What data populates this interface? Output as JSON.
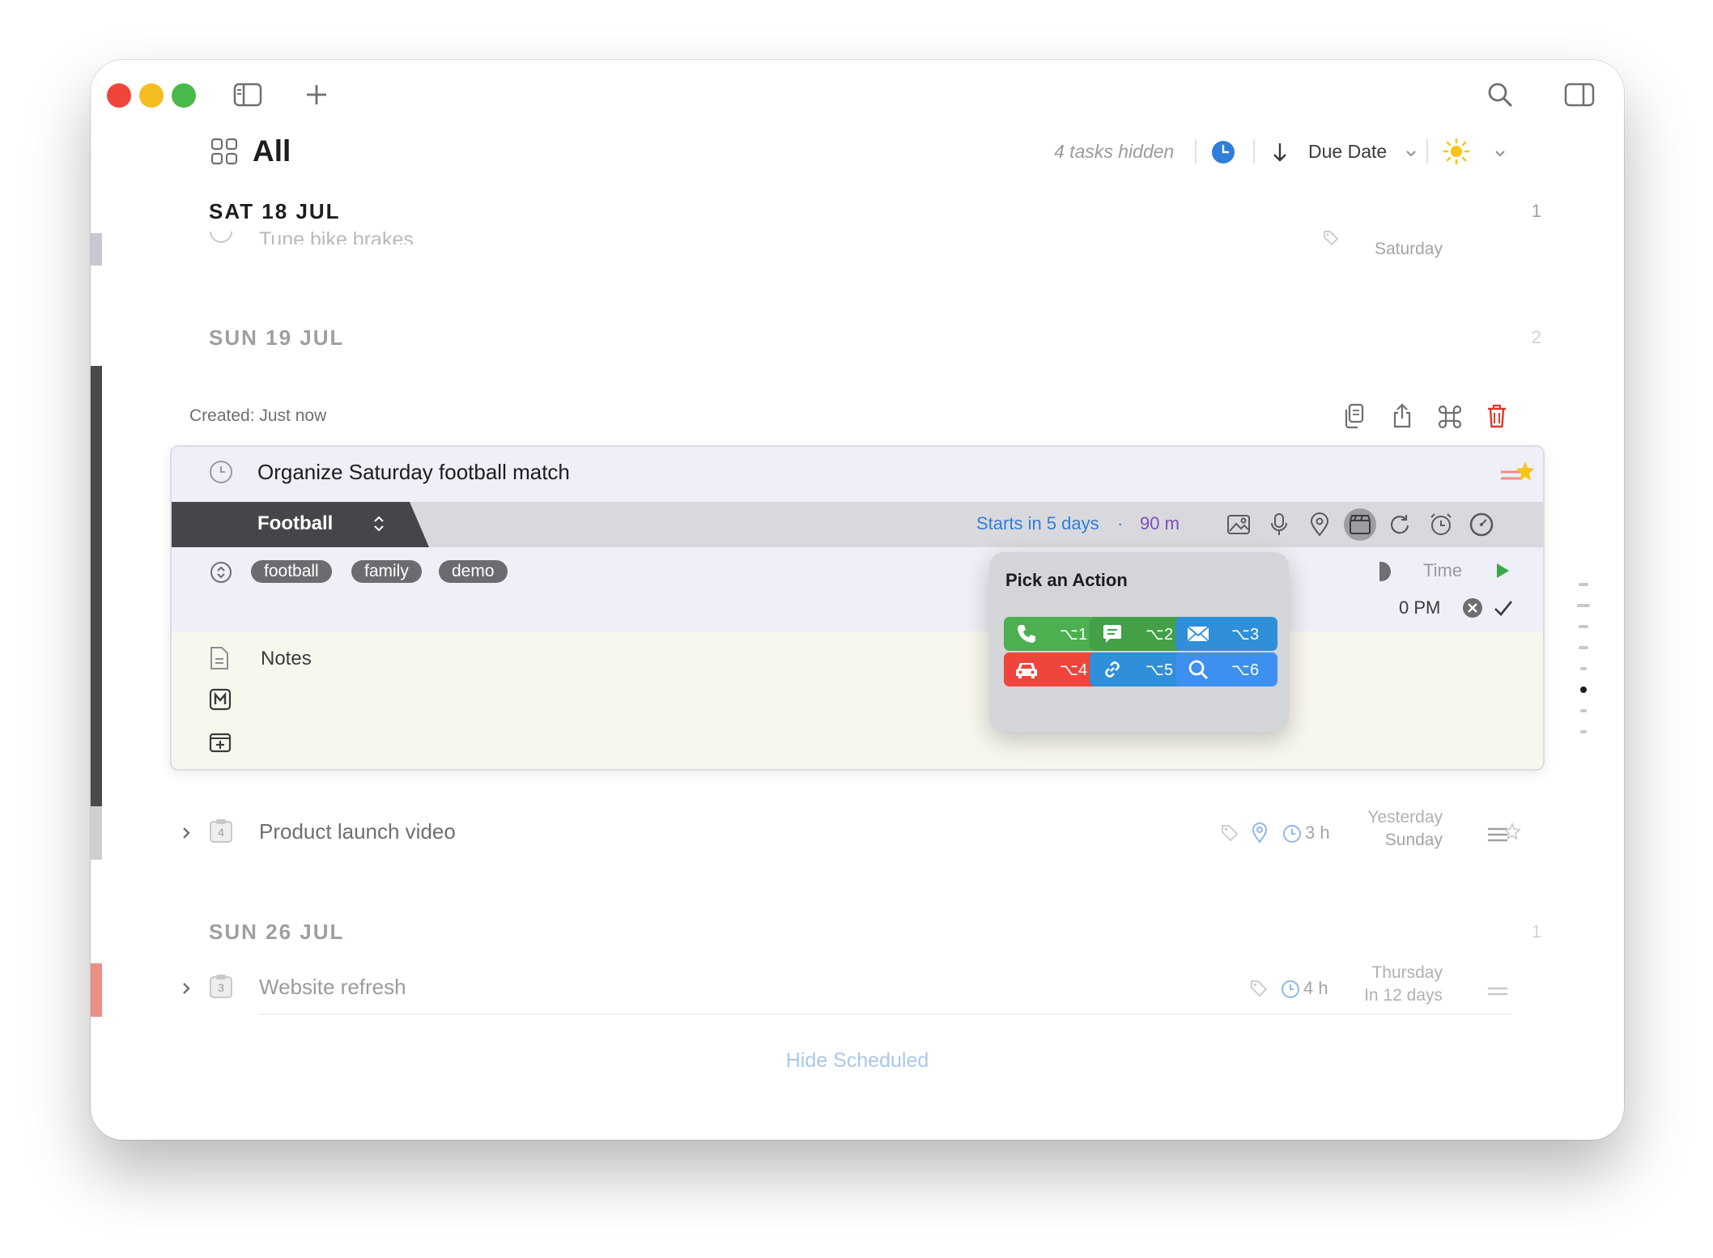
{
  "header": {
    "title": "All",
    "hidden_count": "4 tasks hidden",
    "sort_label": "Due Date"
  },
  "sections": [
    {
      "date": "SAT 18 JUL",
      "count": "1"
    },
    {
      "date": "SUN 19 JUL",
      "count": "2"
    },
    {
      "date": "SUN 26 JUL",
      "count": "1"
    }
  ],
  "tasks": {
    "tune": {
      "title": "Tune bike brakes",
      "date": "Saturday"
    },
    "product": {
      "title": "Product launch video",
      "badge": "4",
      "duration": "3 h",
      "date_line1": "Yesterday",
      "date_line2": "Sunday"
    },
    "website": {
      "title": "Website refresh",
      "badge": "3",
      "duration": "4 h",
      "date_line1": "Thursday",
      "date_line2": "In 12 days"
    }
  },
  "editor": {
    "created": "Created: Just now",
    "title": "Organize Saturday football match",
    "project": "Football",
    "starts": "Starts in 5 days",
    "dot": "·",
    "duration": "90 m",
    "tags": [
      "football",
      "family",
      "demo"
    ],
    "time_label": "Time",
    "time_value": "0 PM",
    "notes_label": "Notes"
  },
  "popover": {
    "title": "Pick an Action",
    "actions": [
      {
        "key": "⌥1",
        "icon": "phone-icon",
        "color": "#4caf50"
      },
      {
        "key": "⌥2",
        "icon": "message-icon",
        "color": "#43a047"
      },
      {
        "key": "⌥3",
        "icon": "mail-icon",
        "color": "#2f8fd8"
      },
      {
        "key": "⌥4",
        "icon": "car-icon",
        "color": "#f0453c"
      },
      {
        "key": "⌥5",
        "icon": "link-icon",
        "color": "#2f8fd8"
      },
      {
        "key": "⌥6",
        "icon": "search-icon",
        "color": "#3d8ff0"
      }
    ]
  },
  "footer": {
    "hide_scheduled": "Hide Scheduled"
  },
  "colors": {
    "accent_blue": "#2f7ed8",
    "duration_purple": "#7a4fc0",
    "delete_red": "#e0362c",
    "footer_link": "#a8c8ea"
  }
}
